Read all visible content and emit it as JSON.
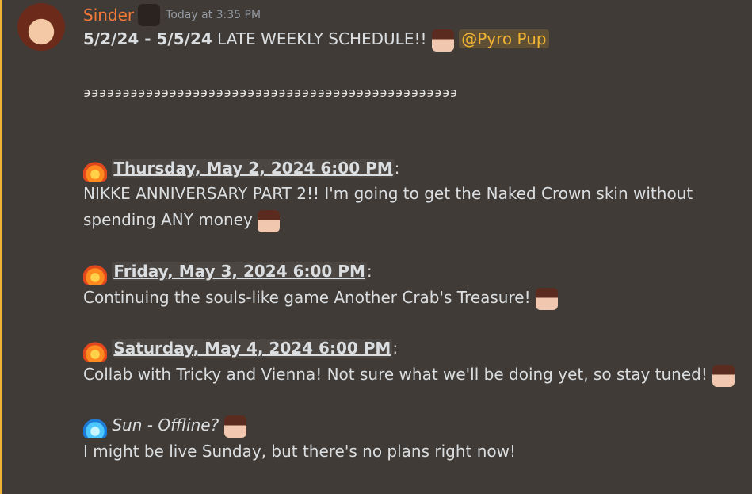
{
  "message": {
    "author": "Sinder",
    "timestamp": "Today at 3:35 PM",
    "title_dates": "5/2/24 - 5/5/24",
    "title_text": "LATE WEEKLY SCHEDULE!!",
    "mention": "@Pyro Pup",
    "divider": "϶϶϶϶϶϶϶϶϶϶϶϶϶϶϶϶϶϶϶϶϶϶϶϶϶϶϶϶϶϶϶϶϶϶϶϶϶϶϶϶϶϶϶϶϶϶϶϶",
    "schedule": [
      {
        "date": "Thursday, May 2, 2024 6:00 PM",
        "line1": "NIKKE ANNIVERSARY PART 2!! I'm going to get the Naked Crown skin without",
        "line2": "spending ANY money"
      },
      {
        "date": "Friday, May 3, 2024 6:00 PM",
        "line1": "Continuing the souls-like game Another Crab's Treasure!"
      },
      {
        "date": "Saturday, May 4, 2024 6:00 PM",
        "line1": "Collab with Tricky and Vienna! Not sure what we'll be doing yet, so stay tuned!"
      },
      {
        "date": "Sun - Offline?",
        "line1": "I might be live Sunday, but there's no plans right now!"
      }
    ]
  },
  "colors": {
    "background": "#403b36",
    "username": "#f37b3a",
    "mention": "#f0b232",
    "text": "#dbdee1",
    "timestamp": "#949ba4"
  },
  "icons": {
    "fire": "fire-emote-icon",
    "blue_fire": "blue-fire-emote-icon",
    "cat": "cat-emote-icon",
    "girl": "girl-emote-icon"
  }
}
